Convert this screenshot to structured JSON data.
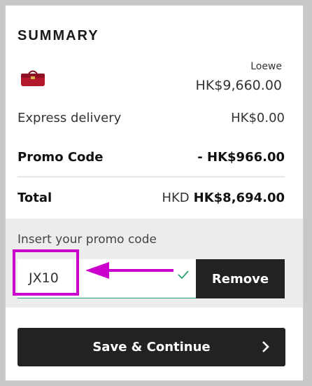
{
  "summary": {
    "title": "SUMMARY",
    "item": {
      "brand": "Loewe",
      "price": "HK$9,660.00",
      "thumbnail_icon": "red-handbag-icon"
    },
    "delivery": {
      "label": "Express delivery",
      "value": "HK$0.00"
    },
    "promo_line": {
      "label": "Promo Code",
      "value": "- HK$966.00"
    },
    "total": {
      "label": "Total",
      "currency": "HKD",
      "value": "HK$8,694.00"
    }
  },
  "promo": {
    "label": "Insert your promo code",
    "input_value": "JX10",
    "valid_icon": "check-icon",
    "remove_label": "Remove"
  },
  "annotation": {
    "color": "#cc00cc"
  },
  "actions": {
    "save_label": "Save & Continue",
    "chevron_icon": "chevron-right-icon"
  },
  "colors": {
    "accent_green": "#2aa26d",
    "button_dark": "#222222",
    "promo_bg": "#ededed"
  }
}
